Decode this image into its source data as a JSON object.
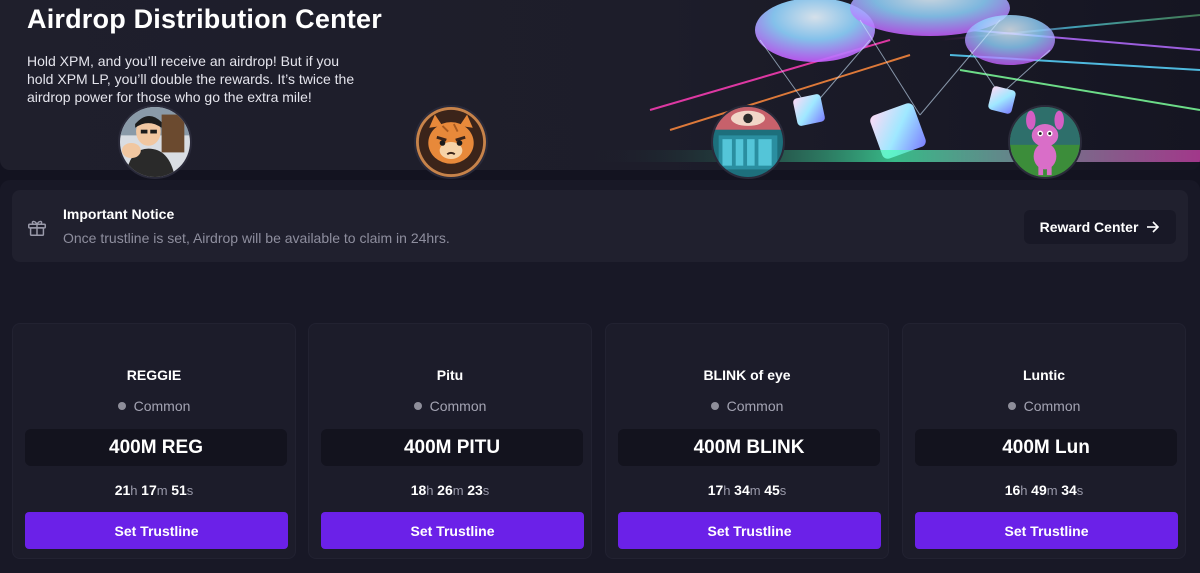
{
  "hero": {
    "title": "Airdrop Distribution Center",
    "description": "Hold XPM, and you’ll receive an airdrop! But if you hold XPM LP, you’ll double the rewards. It’s twice the airdrop power for those who go the extra mile!"
  },
  "notice": {
    "icon": "gift-icon",
    "title": "Important Notice",
    "text": "Once trustline is set, Airdrop will be available to claim in 24hrs.",
    "reward_button": "Reward Center",
    "reward_icon": "arrow-right-icon"
  },
  "colors": {
    "accent": "#6b21e8",
    "background": "#131320",
    "card": "#1c1c2a"
  },
  "cards": [
    {
      "name": "REGGIE",
      "rarity": "Common",
      "amount": "400M REG",
      "timer": {
        "h": "21",
        "m": "17",
        "s": "51",
        "h_unit": "h",
        "m_unit": "m",
        "s_unit": "s"
      },
      "button": "Set Trustline"
    },
    {
      "name": "Pitu",
      "rarity": "Common",
      "amount": "400M PITU",
      "timer": {
        "h": "18",
        "m": "26",
        "s": "23",
        "h_unit": "h",
        "m_unit": "m",
        "s_unit": "s"
      },
      "button": "Set Trustline"
    },
    {
      "name": "BLINK of eye",
      "rarity": "Common",
      "amount": "400M BLINK",
      "timer": {
        "h": "17",
        "m": "34",
        "s": "45",
        "h_unit": "h",
        "m_unit": "m",
        "s_unit": "s"
      },
      "button": "Set Trustline"
    },
    {
      "name": "Luntic",
      "rarity": "Common",
      "amount": "400M Lun",
      "timer": {
        "h": "16",
        "m": "49",
        "s": "34",
        "h_unit": "h",
        "m_unit": "m",
        "s_unit": "s"
      },
      "button": "Set Trustline"
    }
  ]
}
